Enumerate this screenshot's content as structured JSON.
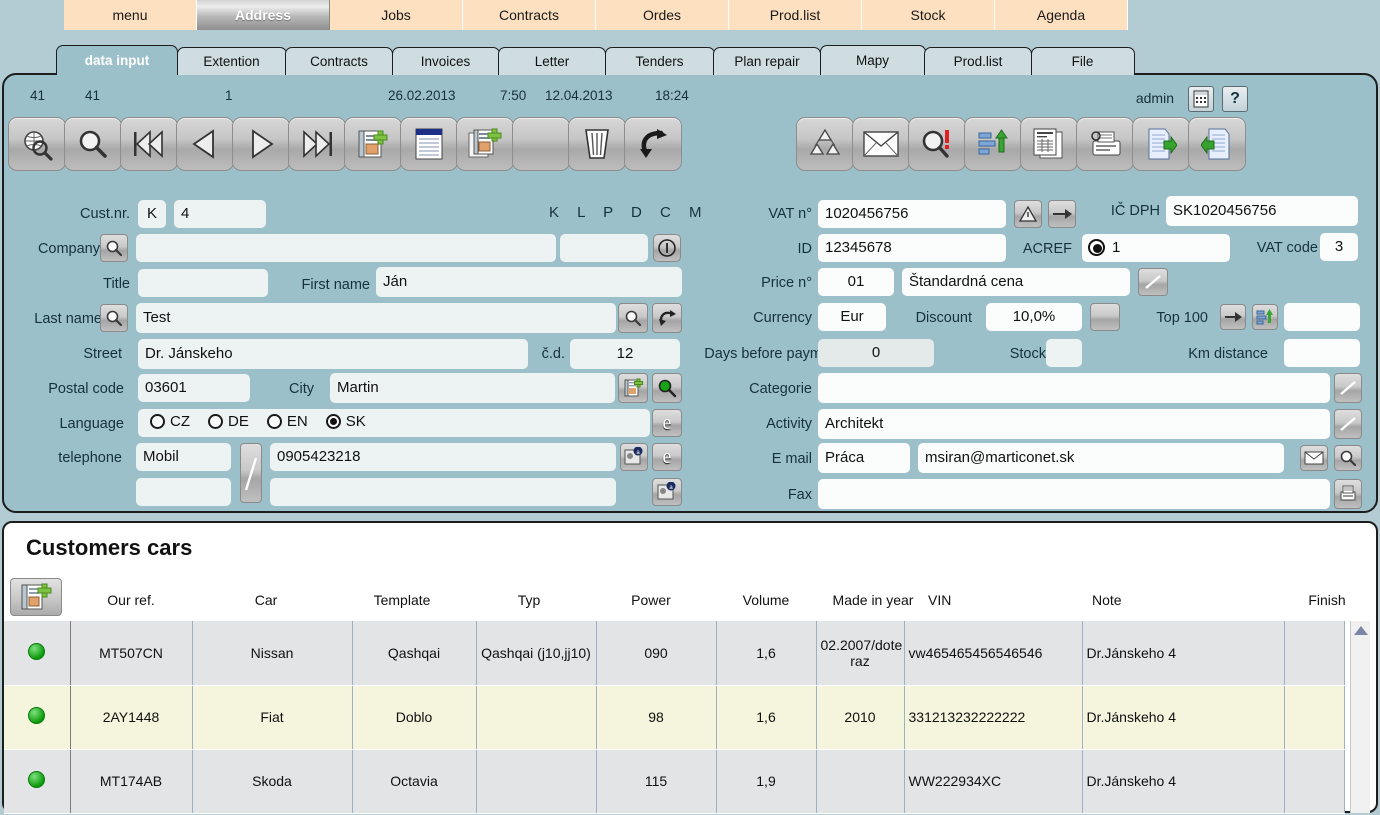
{
  "topmenu": {
    "items": [
      {
        "label": "menu",
        "active": false
      },
      {
        "label": "Address",
        "active": true
      },
      {
        "label": "Jobs",
        "active": false
      },
      {
        "label": "Contracts",
        "active": false
      },
      {
        "label": "Ordes",
        "active": false
      },
      {
        "label": "Prod.list",
        "active": false
      },
      {
        "label": "Stock",
        "active": false
      },
      {
        "label": "Agenda",
        "active": false
      }
    ]
  },
  "subtabs": {
    "items": [
      {
        "label": "data input",
        "active": true
      },
      {
        "label": "Extention",
        "active": false
      },
      {
        "label": "Contracts",
        "active": false
      },
      {
        "label": "Invoices",
        "active": false
      },
      {
        "label": "Letter",
        "active": false
      },
      {
        "label": "Tenders",
        "active": false
      },
      {
        "label": "Plan repair",
        "active": false
      },
      {
        "label": "Mapy",
        "active": false
      },
      {
        "label": "Prod.list",
        "active": false
      },
      {
        "label": "File",
        "active": false
      }
    ]
  },
  "status": {
    "counter1": "41",
    "counter2": "41",
    "counter3": "1",
    "created_date": "26.02.2013",
    "created_time": "7:50",
    "modified_date": "12.04.2013",
    "modified_time": "18:24",
    "user": "admin"
  },
  "form": {
    "cust_nr_label": "Cust.nr.",
    "cust_nr_prefix": "K",
    "cust_nr_value": "4",
    "flags": "K L P D C M",
    "company_label": "Company",
    "company_value": "",
    "company_extra_value": "",
    "title_label": "Title",
    "title_value": "",
    "first_name_label": "First name",
    "first_name_value": "Ján",
    "last_name_label": "Last name",
    "last_name_value": "Test",
    "street_label": "Street",
    "street_value": "Dr. Jánskeho",
    "house_nr_label": "č.d.",
    "house_nr_value": "12",
    "postal_code_label": "Postal code",
    "postal_code_value": "03601",
    "city_label": "City",
    "city_value": "Martin",
    "language_label": "Language",
    "languages": [
      {
        "code": "CZ",
        "selected": false
      },
      {
        "code": "DE",
        "selected": false
      },
      {
        "code": "EN",
        "selected": false
      },
      {
        "code": "SK",
        "selected": true
      }
    ],
    "telephone_label": "telephone",
    "phone_type_1": "Mobil",
    "phone_value_1": "0905423218",
    "phone_type_2": "",
    "phone_value_2": ""
  },
  "right": {
    "vat_nr_label": "VAT n°",
    "vat_nr_value": "1020456756",
    "ic_dph_label": "IČ DPH",
    "ic_dph_value": "SK1020456756",
    "id_label": "ID",
    "id_value": "12345678",
    "acref_label": "ACREF",
    "acref_value": "1",
    "vat_code_label": "VAT code",
    "vat_code_value": "3",
    "price_nr_label": "Price n°",
    "price_nr_value": "01",
    "price_name_value": "Štandardná cena",
    "currency_label": "Currency",
    "currency_value": "Eur",
    "discount_label": "Discount",
    "discount_value": "10,0%",
    "top100_label": "Top 100",
    "top100_value": "",
    "days_before_paym_label": "Days before paym.",
    "days_before_paym_value": "0",
    "stock_label": "Stock",
    "stock_value": "",
    "km_distance_label": "Km distance",
    "km_distance_value": "",
    "categorie_label": "Categorie",
    "categorie_value": "",
    "activity_label": "Activity",
    "activity_value": "Architekt",
    "email_label": "E mail",
    "email_type": "Práca",
    "email_value": "msiran@marticonet.sk",
    "fax_label": "Fax",
    "fax_value": ""
  },
  "cars": {
    "title": "Customers cars",
    "columns": [
      "Our ref.",
      "Car",
      "Template",
      "Typ",
      "Power",
      "Volume",
      "Made in year",
      "VIN",
      "Note",
      "Finish"
    ],
    "rows": [
      {
        "status": "green",
        "our_ref": "MT507CN",
        "car": "Nissan",
        "template": "Qashqai",
        "typ": "Qashqai (j10,jj10)",
        "power": "090",
        "volume": "1,6",
        "made_in_year": "02.2007/dote raz",
        "vin": "vw465465456546546",
        "note": "Dr.Jánskeho 4",
        "finish": ""
      },
      {
        "status": "green",
        "our_ref": "2AY1448",
        "car": "Fiat",
        "template": "Doblo",
        "typ": "",
        "power": "98",
        "volume": "1,6",
        "made_in_year": "2010",
        "vin": "331213232222222",
        "note": "Dr.Jánskeho 4",
        "finish": ""
      },
      {
        "status": "green",
        "our_ref": "MT174AB",
        "car": "Skoda",
        "template": "Octavia",
        "typ": "",
        "power": "115",
        "volume": "1,9",
        "made_in_year": "",
        "vin": "WW222934XC",
        "note": "Dr.Jánskeho 4",
        "finish": ""
      }
    ]
  },
  "colors": {
    "panel_bg": "#9cc0ca",
    "page_bg": "#b3cbd3",
    "menu_bg": "#fde0c0",
    "row_odd": "#e3e4e6",
    "row_even": "#f4f5dc",
    "accent_green": "#0c9c0c"
  }
}
